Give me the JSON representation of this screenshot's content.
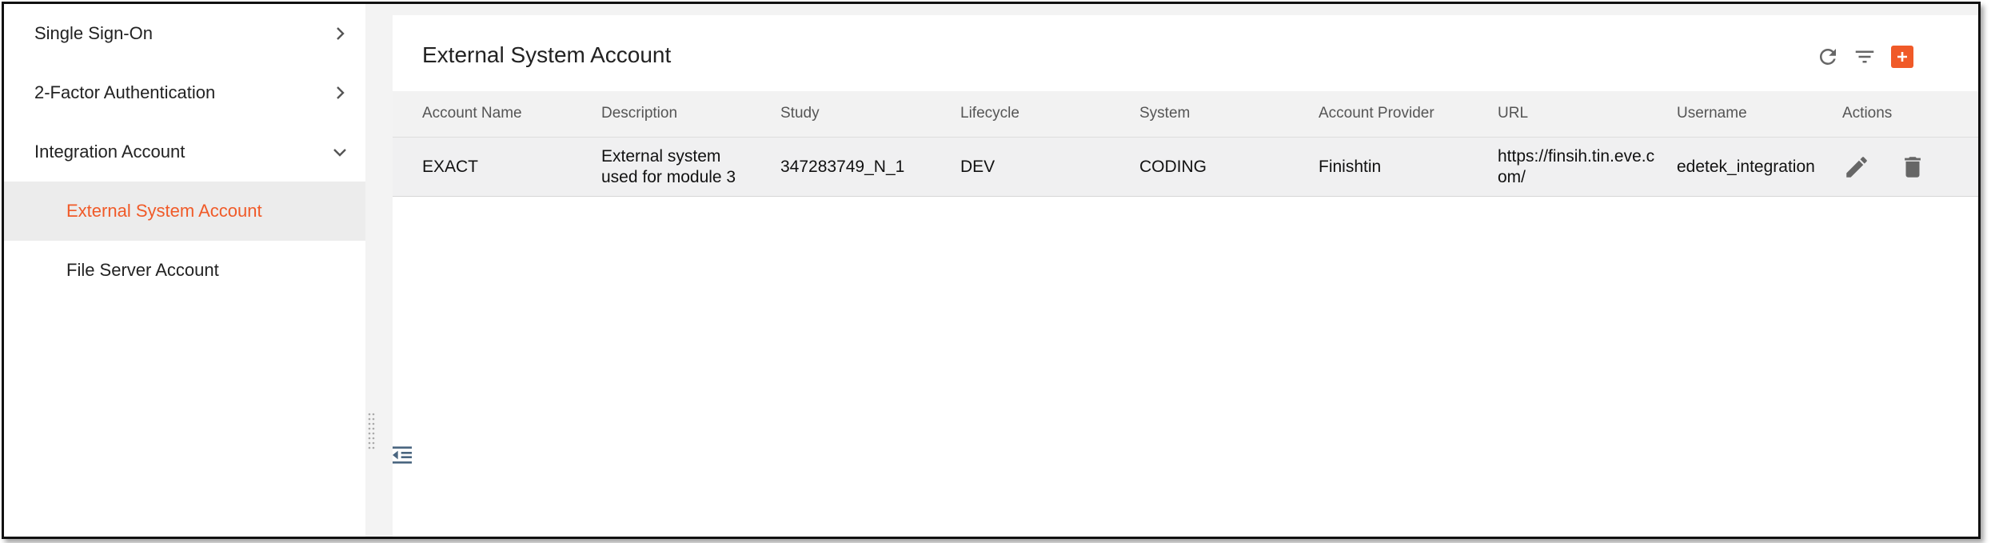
{
  "sidebar": {
    "items": [
      {
        "label": "Single Sign-On"
      },
      {
        "label": "2-Factor Authentication"
      },
      {
        "label": "Integration Account"
      }
    ],
    "sub_items": [
      {
        "label": "External System Account",
        "active": true
      },
      {
        "label": "File Server Account",
        "active": false
      }
    ]
  },
  "panel": {
    "title": "External System Account",
    "toolbar_icons": [
      "refresh-icon",
      "filter-icon",
      "add-icon"
    ]
  },
  "table": {
    "columns": [
      "Account Name",
      "Description",
      "Study",
      "Lifecycle",
      "System",
      "Account Provider",
      "URL",
      "Username",
      "Actions"
    ],
    "rows": [
      {
        "account_name": "EXACT",
        "description": "External system used for module 3",
        "study": "347283749_N_1",
        "lifecycle": "DEV",
        "system": "CODING",
        "account_provider": "Finishtin",
        "url": "https://finsih.tin.eve.com/",
        "username": "edetek_integration"
      }
    ]
  },
  "colors": {
    "accent": "#f05a28",
    "icon_gray": "#666666",
    "row_bg": "#f0f0f1"
  }
}
